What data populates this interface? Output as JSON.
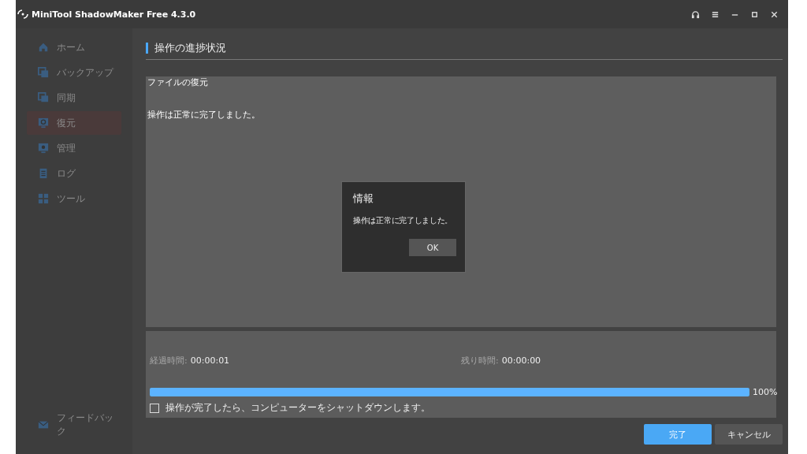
{
  "window": {
    "title": "MiniTool ShadowMaker Free 4.3.0"
  },
  "sidebar": {
    "items": [
      {
        "label": "ホーム",
        "selected": false
      },
      {
        "label": "バックアップ",
        "selected": false
      },
      {
        "label": "同期",
        "selected": false
      },
      {
        "label": "復元",
        "selected": true
      },
      {
        "label": "管理",
        "selected": false
      },
      {
        "label": "ログ",
        "selected": false
      },
      {
        "label": "ツール",
        "selected": false
      }
    ],
    "footer": {
      "label": "フィードバック"
    }
  },
  "section_title": "操作の進捗状況",
  "log": {
    "title": "ファイルの復元",
    "message": "操作は正常に完了しました。"
  },
  "stats": {
    "elapsed_label": "経過時間:",
    "elapsed": "00:00:01",
    "remaining_label": "残り時間:",
    "remaining": "00:00:00",
    "level": 1,
    "percent": "100%"
  },
  "shutdown": {
    "label": "操作が完了したら、コンピューターをシャットダウンします。",
    "checked": false
  },
  "buttons": [
    {
      "label": "完了",
      "primary": true
    },
    {
      "label": "キャンセル",
      "primary": false
    }
  ],
  "dialog": {
    "title": "情報",
    "message": "操作は正常に完了しました。",
    "button": "OK"
  }
}
